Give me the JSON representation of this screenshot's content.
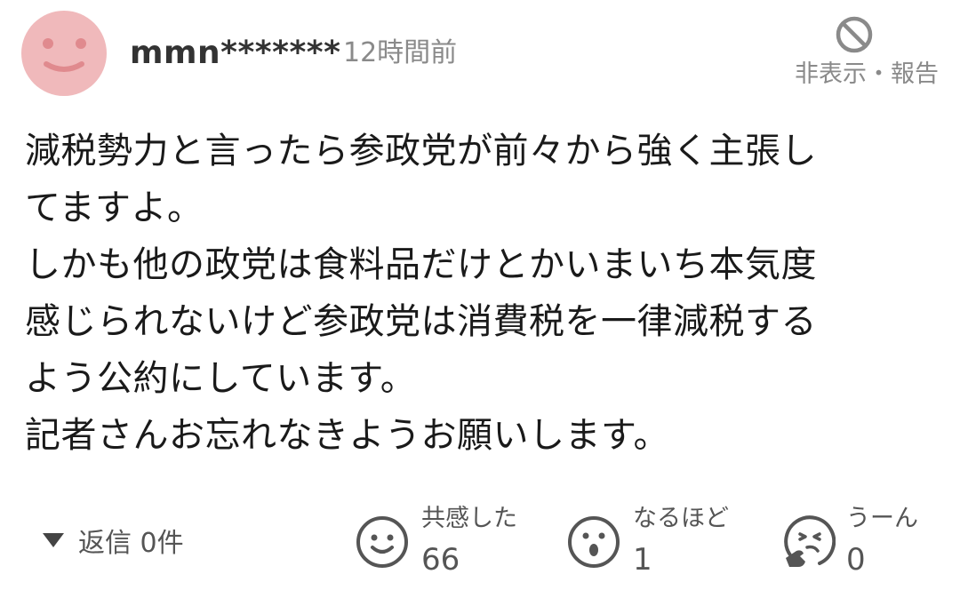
{
  "comment": {
    "username": "mmn*******",
    "timestamp": "12時間前",
    "report_label": "非表示・報告",
    "body_lines": [
      "減税勢力と言ったら参政党が前々から強く主張し",
      "てますよ。",
      "しかも他の政党は食料品だけとかいまいち本気度",
      "感じられないけど参政党は消費税を一律減税する",
      "よう公約にしています。",
      "記者さんお忘れなきようお願いします。"
    ],
    "reply_label": "返信 0件",
    "avatar_color": "#f0b9bb",
    "avatar_feature_color": "#e08a8e"
  },
  "reactions": [
    {
      "label": "共感した",
      "count": "66",
      "icon": "smile-face-icon"
    },
    {
      "label": "なるほど",
      "count": "1",
      "icon": "surprised-face-icon"
    },
    {
      "label": "うーん",
      "count": "0",
      "icon": "thinking-face-icon"
    }
  ]
}
